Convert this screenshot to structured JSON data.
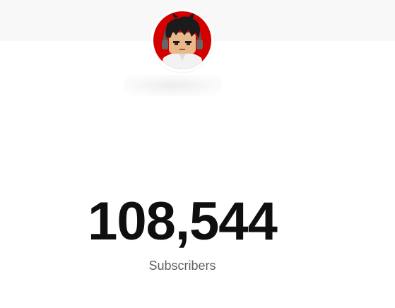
{
  "channel": {
    "avatar_icon": "channel-avatar-icon",
    "avatar_bg_color": "#d40000",
    "subscriber_count": "108,544",
    "subscriber_label": "Subscribers"
  },
  "colors": {
    "banner": "#f8f8f8",
    "count_text": "#0f0f0f",
    "label_text": "#606060"
  }
}
